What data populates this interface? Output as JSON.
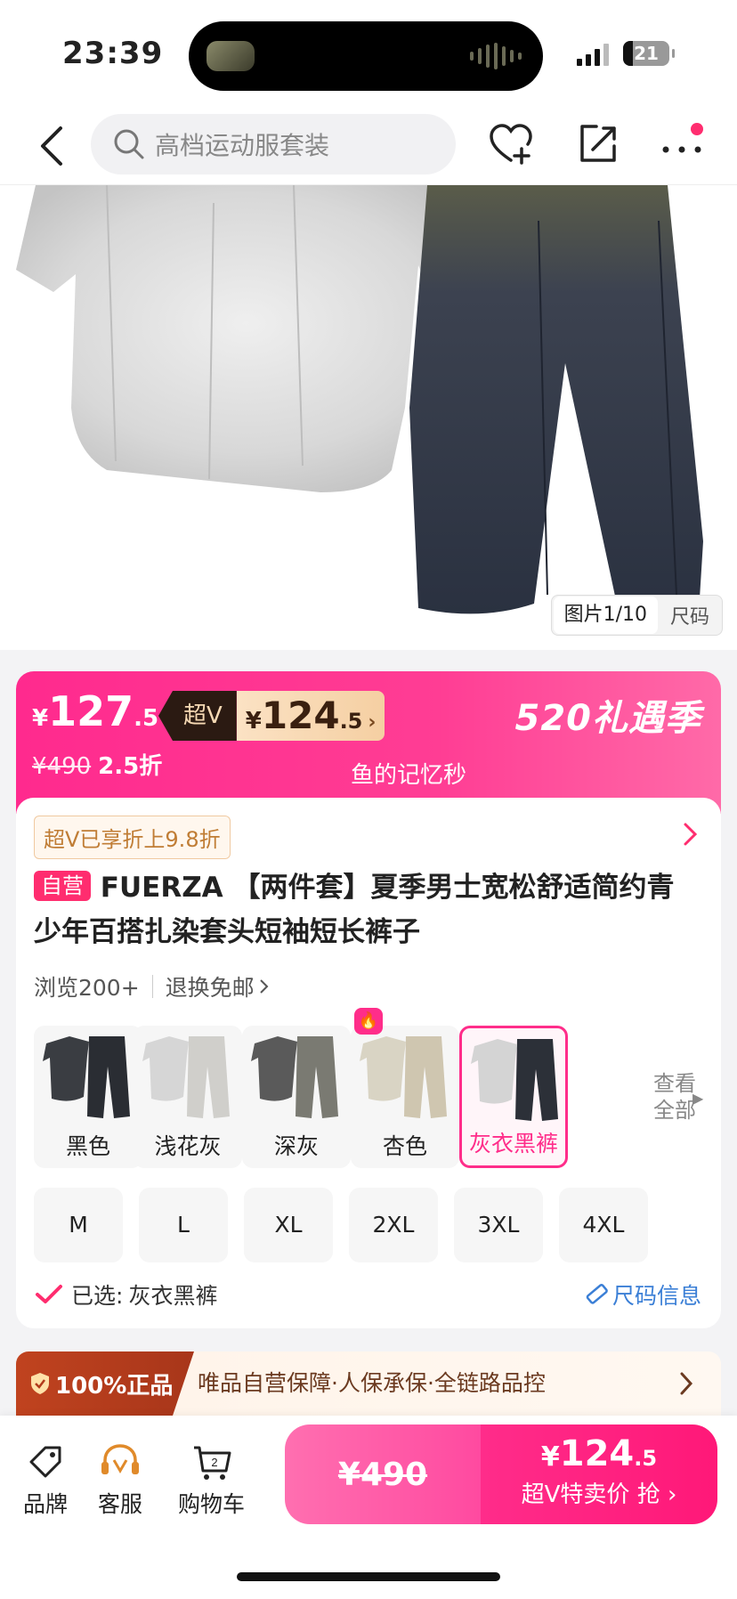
{
  "status_bar": {
    "time": "23:39",
    "battery": "21"
  },
  "nav": {
    "search_placeholder": "高档运动服套装"
  },
  "gallery": {
    "counter": "图片1/10",
    "size_link": "尺码"
  },
  "price": {
    "yen": "¥",
    "integer": "127",
    "decimal": ".5",
    "superv_label": "超V",
    "superv_integer": "124",
    "superv_decimal": ".5",
    "superv_arrow": "›",
    "original": "¥490",
    "discount": "2.5折",
    "event": "520礼遇季",
    "seller": "鱼的记忆秒"
  },
  "info": {
    "svip_badge": "超V已享折上9.8折",
    "self_tag": "自营",
    "title": "FUERZA 【两件套】夏季男士宽松舒适简约青少年百搭扎染套头短袖短长裤子",
    "views": "浏览200+",
    "free_return": "退换免邮",
    "colors": [
      {
        "label": "黑色",
        "top": "#3a3d42",
        "bottom": "#2a2d33"
      },
      {
        "label": "浅花灰",
        "top": "#d6d6d6",
        "bottom": "#d0cfcb"
      },
      {
        "label": "深灰",
        "top": "#5a5a5a",
        "bottom": "#7a7a72"
      },
      {
        "label": "杏色",
        "top": "#d9d4c4",
        "bottom": "#cfc6b0"
      },
      {
        "label": "灰衣黑裤",
        "top": "#d4d4d4",
        "bottom": "#2c3038"
      }
    ],
    "fire_icon": "🔥",
    "view_all": "查看全部",
    "sizes": [
      "M",
      "L",
      "XL",
      "2XL",
      "3XL",
      "4XL"
    ],
    "selected_prefix": "已选:",
    "selected_value": "灰衣黑裤",
    "size_info": "尺码信息"
  },
  "guarantee": {
    "tag": "100%正品",
    "text": "唯品自营保障·人保承保·全链路品控"
  },
  "bottom": {
    "brand": "品牌",
    "service": "客服",
    "cart": "购物车",
    "cart_count": "2",
    "orig_price": "¥490",
    "v_yen": "¥",
    "v_integer": "124",
    "v_decimal": ".5",
    "v_label": "超V特卖价 抢 ›"
  },
  "colors": {
    "accent": "#ff2d8a",
    "link": "#3b7fd6"
  }
}
